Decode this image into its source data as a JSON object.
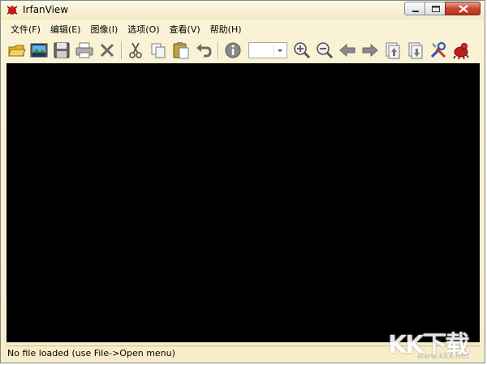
{
  "window": {
    "title": "IrfanView"
  },
  "menu": {
    "items": [
      {
        "label": "文件(F)"
      },
      {
        "label": "编辑(E)"
      },
      {
        "label": "图像(I)"
      },
      {
        "label": "选项(O)"
      },
      {
        "label": "查看(V)"
      },
      {
        "label": "帮助(H)"
      }
    ]
  },
  "toolbar": {
    "icons": [
      "open-folder-icon",
      "slideshow-icon",
      "save-icon",
      "print-icon",
      "delete-icon",
      "cut-icon",
      "copy-icon",
      "paste-icon",
      "undo-icon",
      "info-icon",
      "zoom-in-icon",
      "zoom-out-icon",
      "previous-icon",
      "next-icon",
      "first-page-icon",
      "last-page-icon",
      "settings-icon",
      "irfanview-logo-icon"
    ],
    "zoom_value": ""
  },
  "status": {
    "text": "No file loaded (use File->Open menu)"
  },
  "watermark": {
    "logo_text": "KK下载",
    "url": "www.kkx.net"
  },
  "colors": {
    "chrome": "#f7eec8",
    "canvas": "#000000",
    "close_button": "#c8472d"
  }
}
